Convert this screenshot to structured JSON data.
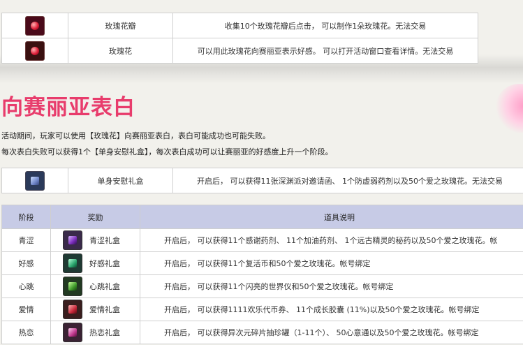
{
  "item_table": {
    "rows": [
      {
        "icon": "rose-petals-icon",
        "name": "玫瑰花瓣",
        "description": "收集10个玫瑰花瓣后点击， 可以制作1朵玫瑰花。无法交易"
      },
      {
        "icon": "rose-icon",
        "name": "玫瑰花",
        "description": "可以用此玫瑰花向赛丽亚表示好感。 可以打开活动窗口查看详情。无法交易"
      }
    ]
  },
  "section": {
    "title": "向赛丽亚表白",
    "line1": "活动期间，玩家可以使用【玫瑰花】向赛丽亚表白，表白可能成功也可能失败。",
    "line2": "每次表白失败可以获得1个【单身安慰礼盒】，每次表白成功可以让赛丽亚的好感度上升一个阶段。"
  },
  "consolation_table": {
    "icon": "consolation-box-icon",
    "name": "单身安慰礼盒",
    "description": "开启后， 可以获得11张深渊派对邀请函、 1个防虚弱药剂以及50个爱之玫瑰花。无法交易"
  },
  "stage_table": {
    "headers": {
      "stage": "阶段",
      "reward": "奖励",
      "description": "道具说明"
    },
    "rows": [
      {
        "stage": "青涩",
        "icon": "green-gift-box-icon",
        "reward": "青涩礼盒",
        "description": "开启后， 可以获得11个感谢药剂、 11个加油药剂、 1个远古精灵的秘药以及50个爱之玫瑰花。帐"
      },
      {
        "stage": "好感",
        "icon": "favor-gift-box-icon",
        "reward": "好感礼盒",
        "description": "开启后， 可以获得11个复活币和50个爱之玫瑰花。帐号绑定"
      },
      {
        "stage": "心跳",
        "icon": "heartbeat-gift-box-icon",
        "reward": "心跳礼盒",
        "description": "开启后， 可以获得11个闪亮的世界仪和50个爱之玫瑰花。帐号绑定"
      },
      {
        "stage": "爱情",
        "icon": "love-gift-box-icon",
        "reward": "爱情礼盒",
        "description": "开启后， 可以获得1111欢乐代币券、 11个成长胶囊 (11%)以及50个爱之玫瑰花。帐号绑定"
      },
      {
        "stage": "热恋",
        "icon": "passion-gift-box-icon",
        "reward": "热恋礼盒",
        "description": "开启后， 可以获得异次元碎片抽珍罐（1-11个）、 50心意通以及50个爱之玫瑰花。帐号绑定"
      }
    ]
  }
}
